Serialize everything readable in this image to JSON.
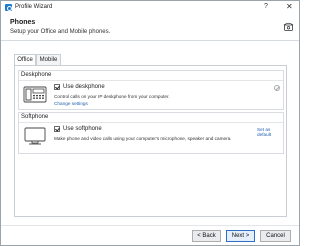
{
  "window": {
    "title": "Profile Wizard",
    "help_glyph": "?",
    "close_glyph": "✕"
  },
  "header": {
    "title": "Phones",
    "subtitle": "Setup your Office and Mobile phones."
  },
  "tabs": [
    {
      "label": "Office"
    },
    {
      "label": "Mobile"
    }
  ],
  "deskphone": {
    "section_title": "Deskphone",
    "checkbox_label": "Use deskphone",
    "checked": true,
    "description": "Control calls on your IP deskphone from your computer.",
    "link": "Change settings"
  },
  "softphone": {
    "section_title": "Softphone",
    "checkbox_label": "Use softphone",
    "checked": true,
    "description": "Make phone and video calls using your computer's microphone, speaker and camera.",
    "link": "Set as default"
  },
  "footer": {
    "back": "< Back",
    "next": "Next >",
    "cancel": "Cancel"
  }
}
